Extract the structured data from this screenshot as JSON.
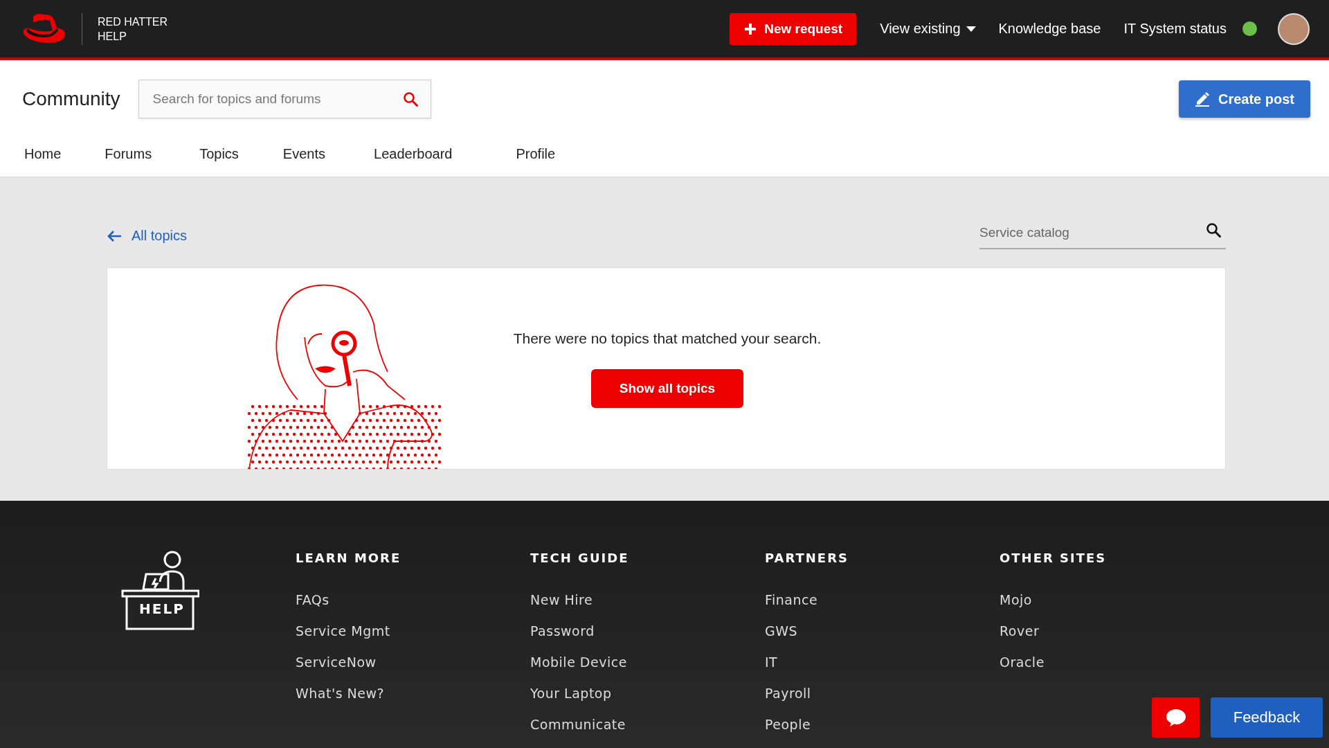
{
  "header": {
    "brand": [
      "RED HATTER",
      "HELP"
    ],
    "new_request": "New request",
    "view_existing": "View existing",
    "knowledge_base": "Knowledge base",
    "status": {
      "label": "IT System status",
      "color": "#6cc04a"
    }
  },
  "community": {
    "title": "Community",
    "search": {
      "placeholder": "Search for topics and forums"
    },
    "create_post": "Create post",
    "tabs": [
      {
        "label": "Home",
        "selected": false
      },
      {
        "label": "Forums",
        "selected": false
      },
      {
        "label": "Topics",
        "selected": false
      },
      {
        "label": "Events",
        "selected": false
      },
      {
        "label": "Leaderboard",
        "selected": false
      },
      {
        "label": "Profile",
        "selected": false
      }
    ]
  },
  "content": {
    "back_link": "All topics",
    "catalog_search": {
      "placeholder": "Service catalog"
    },
    "empty_message": "There were no topics that matched your search.",
    "show_all": "Show all topics"
  },
  "footer": {
    "logo_text": "HELP",
    "columns": [
      {
        "heading": "LEARN MORE",
        "links": [
          "FAQs",
          "Service Mgmt",
          "ServiceNow",
          "What's New?"
        ]
      },
      {
        "heading": "TECH GUIDE",
        "links": [
          "New Hire",
          "Password",
          "Mobile Device",
          "Your Laptop",
          "Communicate"
        ]
      },
      {
        "heading": "PARTNERS",
        "links": [
          "Finance",
          "GWS",
          "IT",
          "Payroll",
          "People"
        ]
      },
      {
        "heading": "OTHER SITES",
        "links": [
          "Mojo",
          "Rover",
          "Oracle"
        ]
      }
    ]
  },
  "feedback": "Feedback"
}
